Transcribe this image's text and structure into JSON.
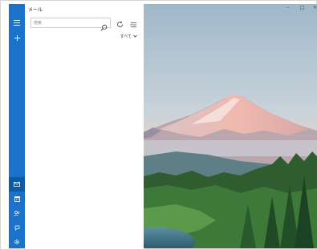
{
  "app": {
    "title": "メール"
  },
  "search": {
    "placeholder": "検索"
  },
  "list": {
    "filter_label": "すべて"
  },
  "window_controls": {
    "minimize": "–",
    "maximize": "□",
    "close": "×"
  },
  "icons": {
    "menu": "hamburger-menu-icon",
    "compose": "plus-icon",
    "mail": "mail-icon",
    "calendar": "calendar-icon",
    "people": "people-icon",
    "feedback": "feedback-icon",
    "settings": "gear-icon",
    "search": "search-icon",
    "sync": "sync-icon",
    "select": "selection-mode-icon",
    "filter": "chevron-down-icon"
  },
  "colors": {
    "rail": "#1a73c8",
    "rail_active": "#0f5aa5",
    "pane": "#ffffff",
    "sky_top": "#9fb8c9",
    "sky_bottom": "#f1d3c0",
    "forest": "#2f5d2f"
  }
}
